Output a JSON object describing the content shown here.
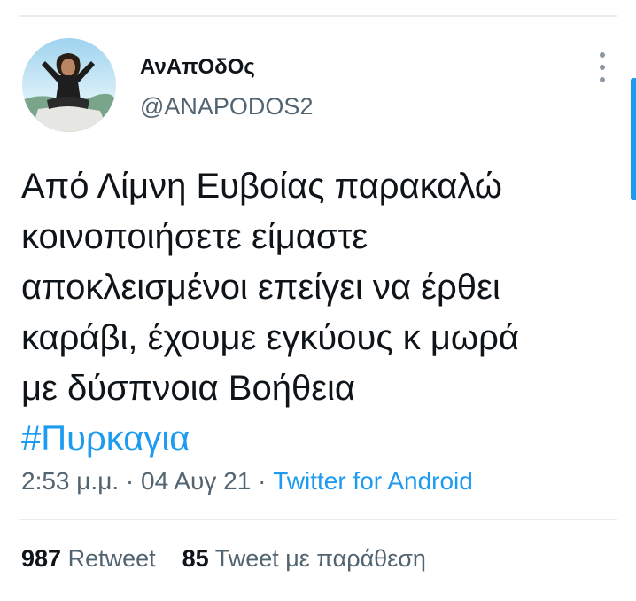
{
  "tweet": {
    "author": {
      "display_name": "ΑνΑπΟδΟς",
      "handle": "@ANAPODOS2",
      "avatar_icon": "user-avatar-photo"
    },
    "more_icon": "more-vertical-icon",
    "text_lines": [
      "Από Λίμνη Ευβοίας παρακαλώ",
      "κοινοποιήσετε είμαστε",
      "αποκλεισμένοι επείγει να έρθει",
      "καράβι, έχουμε εγκύους κ μωρά",
      "με δύσπνοια  Βοήθεια"
    ],
    "hashtag": "#Πυρκαγια",
    "time": "2:53 μ.μ.",
    "separator": " · ",
    "date": "04 Αυγ 21",
    "source": "Twitter for Android",
    "stats": {
      "retweets_count": "987",
      "retweets_label": "Retweet",
      "quotes_count": "85",
      "quotes_label": "Tweet με παράθεση"
    }
  },
  "colors": {
    "text": "#0f1419",
    "secondary_text": "#536471",
    "link": "#1d9bf0",
    "divider": "#e8ecef"
  }
}
